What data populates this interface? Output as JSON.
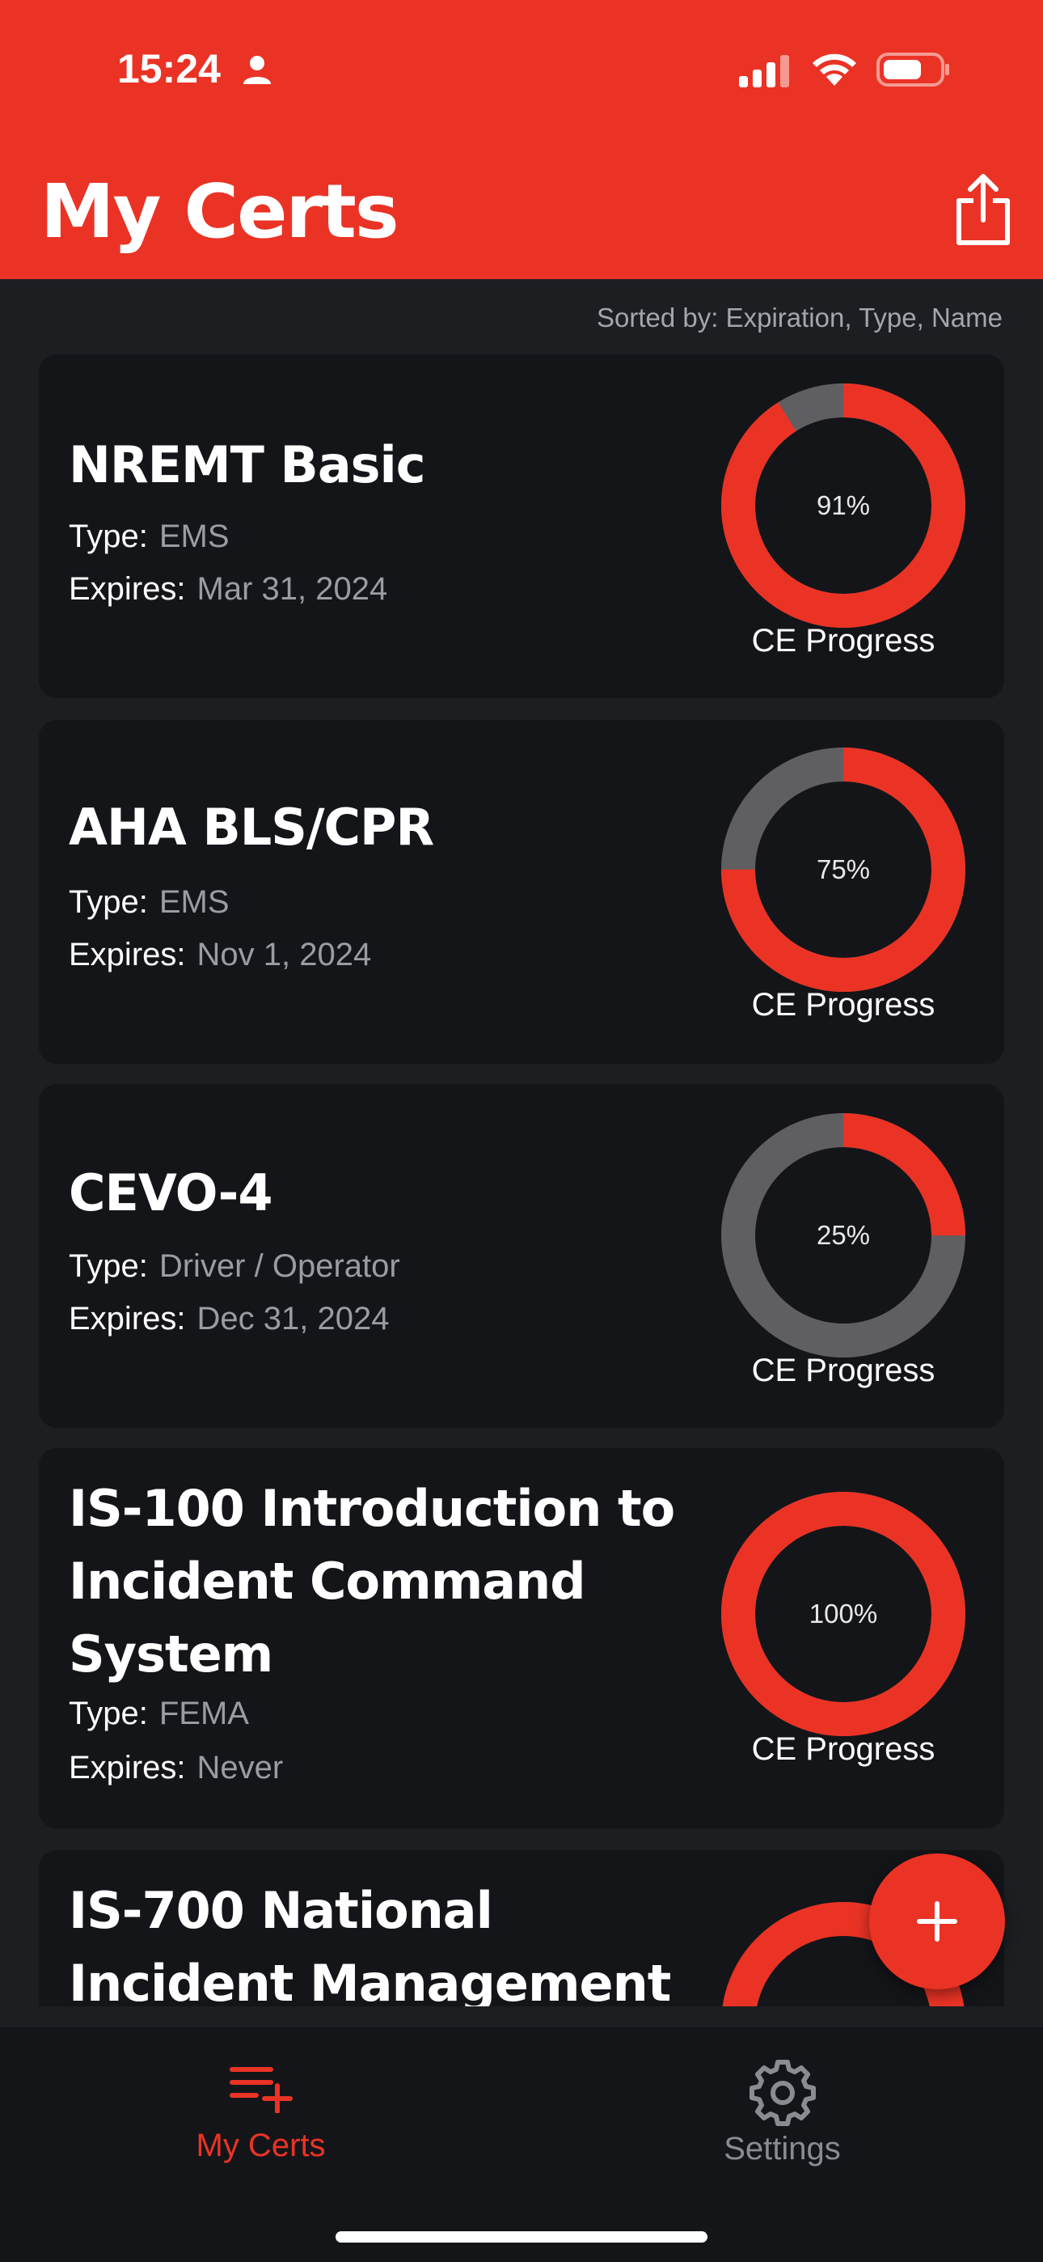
{
  "status_bar": {
    "time": "15:24"
  },
  "header": {
    "title": "My Certs",
    "share_icon": "share-icon"
  },
  "sort_label": "Sorted by: Expiration, Type, Name",
  "labels": {
    "type": "Type:",
    "expires": "Expires:",
    "ce_progress": "CE Progress"
  },
  "colors": {
    "accent": "#ea3325",
    "ring_track": "#5f5f61",
    "card": "#141519",
    "background": "#1c1e22"
  },
  "certs": [
    {
      "name": "NREMT Basic",
      "type": "EMS",
      "expires": "Mar 31, 2024",
      "progress": 0.91,
      "progress_label": "91%"
    },
    {
      "name": "AHA BLS/CPR",
      "type": "EMS",
      "expires": "Nov 1, 2024",
      "progress": 0.75,
      "progress_label": "75%"
    },
    {
      "name": "CEVO-4",
      "type": "Driver / Operator",
      "expires": "Dec 31, 2024",
      "progress": 0.25,
      "progress_label": "25%"
    },
    {
      "name": "IS-100 Introduction to Incident Command System",
      "type": "FEMA",
      "expires": "Never",
      "progress": 1.0,
      "progress_label": "100%"
    },
    {
      "name": "IS-700 National Incident Management"
    }
  ],
  "fab": {
    "icon": "plus-icon"
  },
  "tabbar": {
    "tabs": [
      {
        "label": "My Certs",
        "icon": "list-add-icon",
        "active": true
      },
      {
        "label": "Settings",
        "icon": "gear-icon",
        "active": false
      }
    ]
  }
}
